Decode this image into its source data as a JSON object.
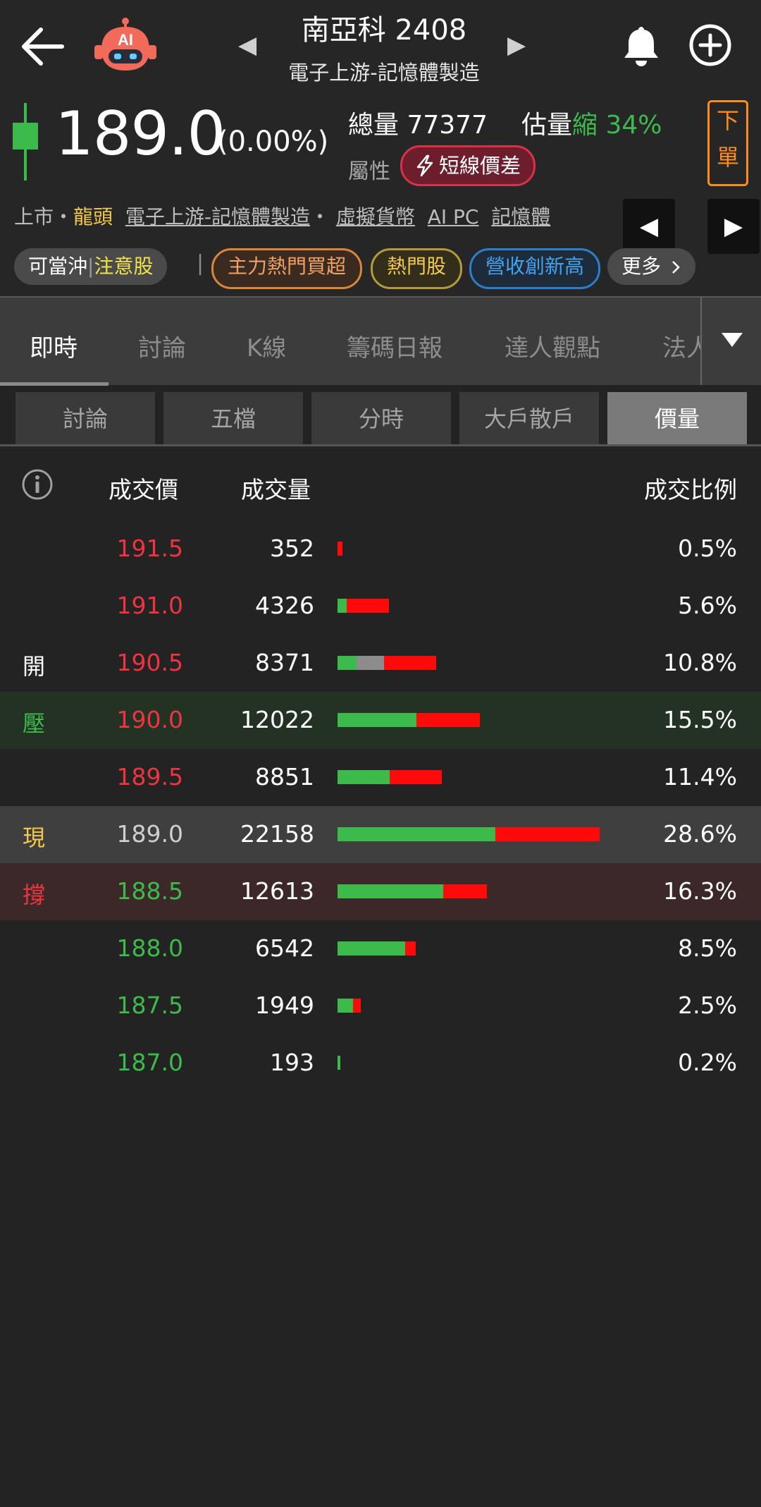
{
  "header": {
    "title": "南亞科 2408",
    "subtitle": "電子上游-記憶體製造",
    "prev_arrow": "◀",
    "next_arrow": "▶",
    "ai_badge": "AI"
  },
  "quote": {
    "price": "189.0",
    "change": "(0.00%)",
    "total_volume_label": "總量",
    "total_volume": "77377",
    "estimate_label": "估量",
    "estimate_direction": "縮",
    "estimate_pct": "34%",
    "attribute_label": "屬性",
    "attribute_tag": "短線價差",
    "order_button_top": "下",
    "order_button_bottom": "單"
  },
  "tags": {
    "market": "上市",
    "dot1": "・",
    "leader": "龍頭",
    "industry": "電子上游-記憶體製造",
    "dot2": "・",
    "concepts": [
      "虛擬貨幣",
      "AI PC",
      "記憶體"
    ],
    "pills": {
      "day_trade": "可當沖",
      "separator": "|",
      "warning": "注意股",
      "bar": "|",
      "main_force": "主力熱門買超",
      "hot": "熱門股",
      "revenue_high": "營收創新高",
      "more": "更多"
    }
  },
  "tabs": [
    "即時",
    "討論",
    "K線",
    "籌碼日報",
    "達人觀點",
    "法人"
  ],
  "subtabs": [
    "討論",
    "五檔",
    "分時",
    "大戶散戶",
    "價量"
  ],
  "table": {
    "headers": {
      "price": "成交價",
      "volume": "成交量",
      "ratio": "成交比例"
    },
    "rows": [
      {
        "mark": "",
        "price": "191.5",
        "volume": "352",
        "pct": "0.5%",
        "green": 0.0,
        "gray": 0.0,
        "red": 0.5
      },
      {
        "mark": "",
        "price": "191.0",
        "volume": "4326",
        "pct": "5.6%",
        "green": 1.0,
        "gray": 0.0,
        "red": 4.6
      },
      {
        "mark": "開",
        "price": "190.5",
        "volume": "8371",
        "pct": "10.8%",
        "green": 2.1,
        "gray": 3.0,
        "red": 5.7
      },
      {
        "mark": "壓",
        "price": "190.0",
        "volume": "12022",
        "pct": "15.5%",
        "green": 8.6,
        "gray": 0.0,
        "red": 6.9
      },
      {
        "mark": "",
        "price": "189.5",
        "volume": "8851",
        "pct": "11.4%",
        "green": 5.7,
        "gray": 0.0,
        "red": 5.7
      },
      {
        "mark": "現",
        "price": "189.0",
        "volume": "22158",
        "pct": "28.6%",
        "green": 17.2,
        "gray": 0.0,
        "red": 11.4
      },
      {
        "mark": "撐",
        "price": "188.5",
        "volume": "12613",
        "pct": "16.3%",
        "green": 11.5,
        "gray": 0.0,
        "red": 4.8
      },
      {
        "mark": "",
        "price": "188.0",
        "volume": "6542",
        "pct": "8.5%",
        "green": 7.4,
        "gray": 0.0,
        "red": 1.1
      },
      {
        "mark": "",
        "price": "187.5",
        "volume": "1949",
        "pct": "2.5%",
        "green": 1.7,
        "gray": 0.0,
        "red": 0.8
      },
      {
        "mark": "",
        "price": "187.0",
        "volume": "193",
        "pct": "0.2%",
        "green": 0.2,
        "gray": 0.0,
        "red": 0.0
      }
    ]
  },
  "colors": {
    "up": "#f0343f",
    "down": "#3cba4c",
    "flat": "#cfcfcf",
    "bar_green": "#3cba4c",
    "bar_red": "#ff0a0a",
    "bar_gray": "#8c8c8c"
  }
}
